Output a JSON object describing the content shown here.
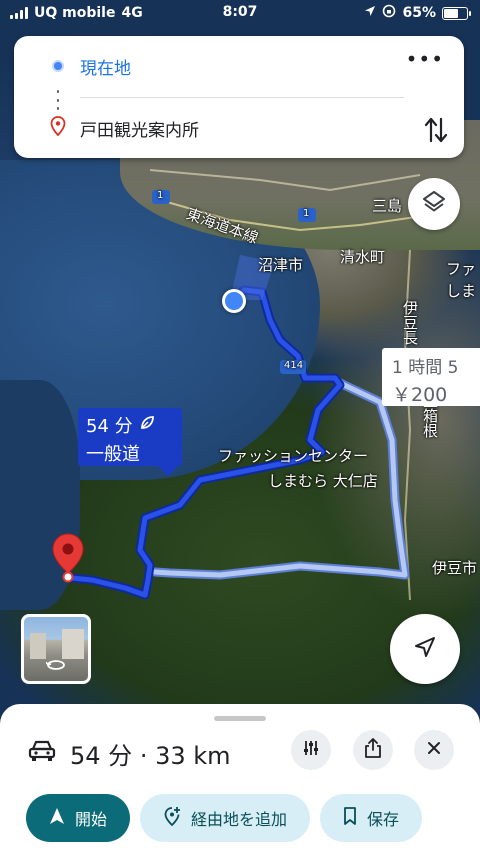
{
  "status_bar": {
    "carrier": "UQ mobile",
    "network": "4G",
    "time": "8:07",
    "battery": "65%",
    "battery_level": 0.65
  },
  "directions": {
    "origin": "現在地",
    "destination": "戸田観光案内所"
  },
  "map": {
    "labels": {
      "tokaido": "東海道本線",
      "numazu": "沼津市",
      "shimizu": "清水町",
      "mishima": "三島",
      "izunagaoka": "伊豆長",
      "izuline": "伊豆箱根",
      "fa": "ファ",
      "shima": "しま",
      "izu_city": "伊豆市",
      "shimamura_1": "ファッションセンター",
      "shimamura_2": "しまむら 大仁店",
      "route_414": "414",
      "route_1a": "1",
      "route_1b": "1"
    }
  },
  "route_primary": {
    "duration": "54 分",
    "type": "一般道"
  },
  "route_alt": {
    "duration": "1 時間 5",
    "toll": "￥200"
  },
  "summary": {
    "duration": "54 分",
    "separator": "·",
    "distance": "33 km"
  },
  "actions": {
    "start": "開始",
    "add_waypoint": "経由地を追加",
    "save": "保存"
  },
  "colors": {
    "route_primary": "#1a3cc4",
    "route_alt": "#b4c8f2",
    "accent": "#0b6b78"
  }
}
